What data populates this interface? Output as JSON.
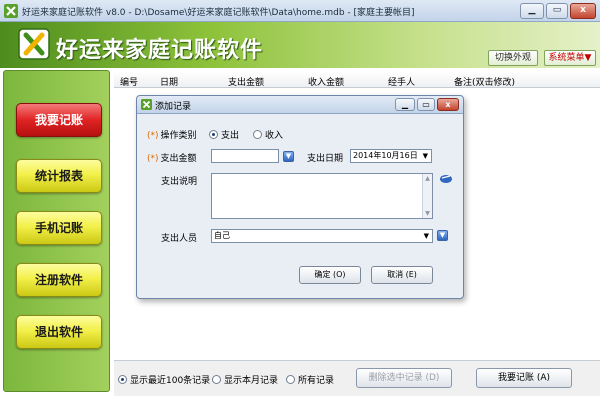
{
  "window": {
    "title": "好运来家庭记账软件 v8.0 - D:\\Dosame\\好运来家庭记账软件\\Data\\home.mdb - [家庭主要帐目]",
    "minimize": "▁",
    "maximize": "▭",
    "close": "x"
  },
  "header": {
    "app_name": "好运来家庭记账软件",
    "switch_skin_label": "切换外观",
    "system_menu_label": "系统菜单▼",
    "accent_color": "#8dc23a"
  },
  "sidebar": {
    "items": [
      {
        "label": "我要记账",
        "active": true
      },
      {
        "label": "统计报表",
        "active": false
      },
      {
        "label": "手机记账",
        "active": false
      },
      {
        "label": "注册软件",
        "active": false
      },
      {
        "label": "退出软件",
        "active": false
      }
    ]
  },
  "table": {
    "columns": [
      "编号",
      "日期",
      "支出金额",
      "收入金额",
      "经手人",
      "备注(双击修改)"
    ]
  },
  "bottom": {
    "radios": [
      {
        "label": "显示最近100条记录",
        "checked": true
      },
      {
        "label": "显示本月记录",
        "checked": false
      },
      {
        "label": "所有记录",
        "checked": false
      }
    ],
    "delete_button": "删除选中记录 (D)",
    "record_button": "我要记账 (A)"
  },
  "dialog": {
    "title": "添加记录",
    "op_type_label": "操作类别",
    "op_type_options": [
      {
        "label": "支出",
        "checked": true
      },
      {
        "label": "收入",
        "checked": false
      }
    ],
    "amount_label": "支出金额",
    "amount_value": "",
    "date_label": "支出日期",
    "date_value": "2014年10月16日",
    "desc_label": "支出说明",
    "desc_value": "",
    "person_label": "支出人员",
    "person_value": "自己",
    "required_mark": "(*)",
    "ok_button": "确定 (O)",
    "cancel_button": "取消 (E)",
    "minimize": "▁",
    "maximize": "▭",
    "close": "x"
  }
}
